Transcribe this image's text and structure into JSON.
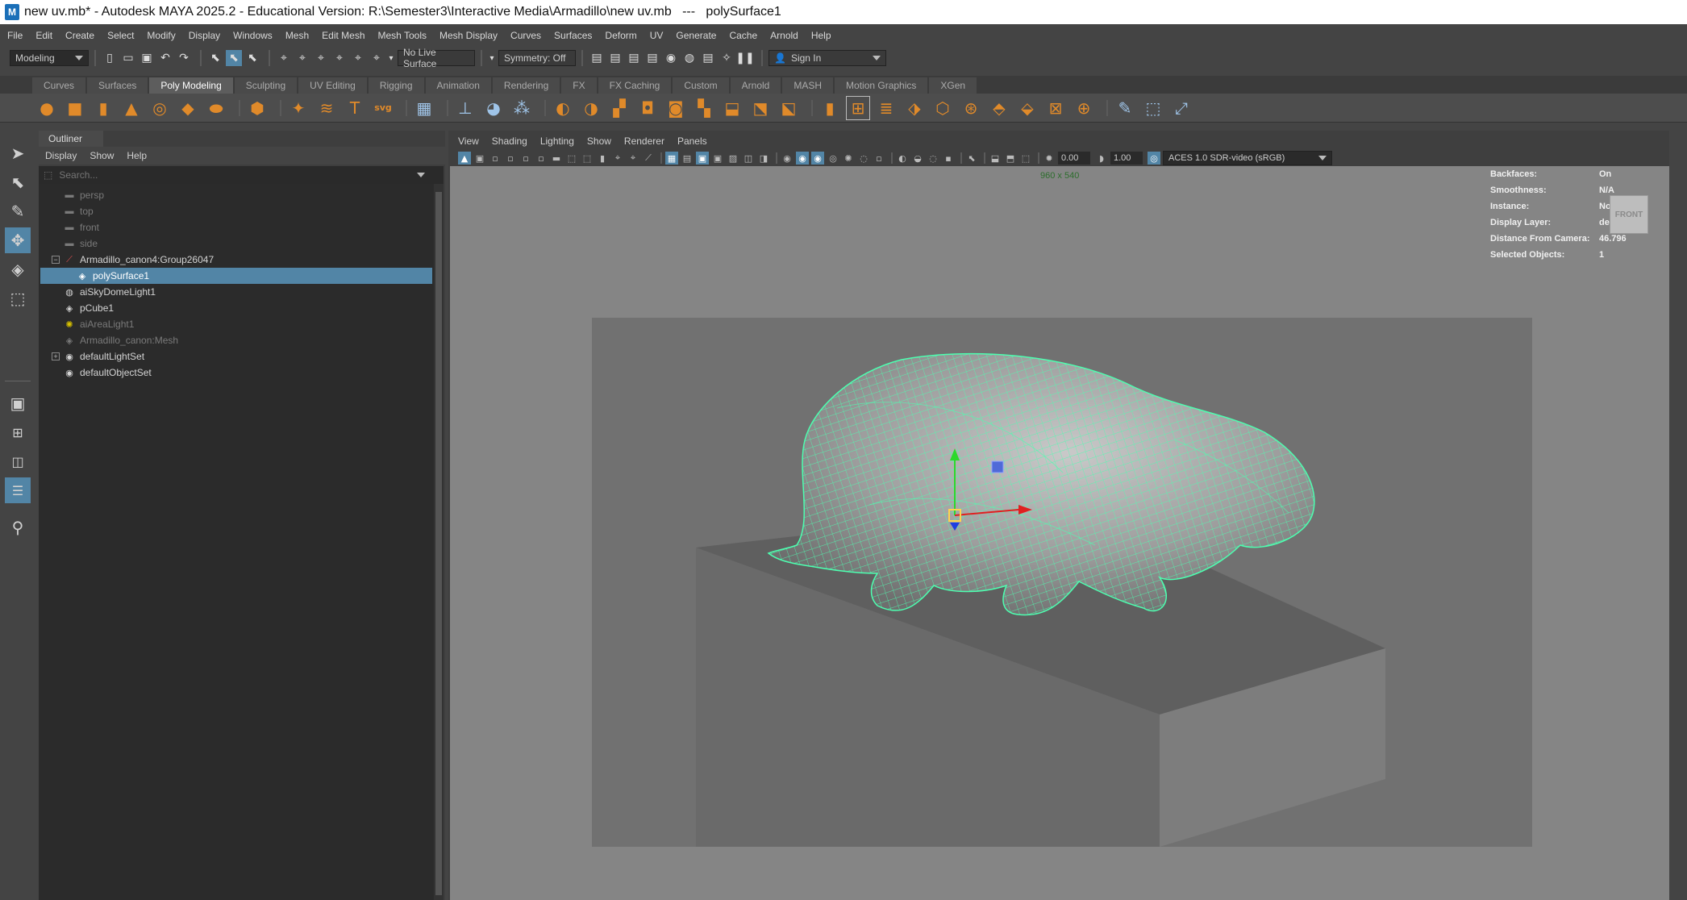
{
  "titlebar": {
    "title": "new uv.mb* - Autodesk MAYA 2025.2 - Educational Version: R:\\Semester3\\Interactive Media\\Armadillo\\new uv.mb   ---   polySurface1",
    "icon_letter": "M"
  },
  "menubar": {
    "items": [
      "File",
      "Edit",
      "Create",
      "Select",
      "Modify",
      "Display",
      "Windows",
      "Mesh",
      "Edit Mesh",
      "Mesh Tools",
      "Mesh Display",
      "Curves",
      "Surfaces",
      "Deform",
      "UV",
      "Generate",
      "Cache",
      "Arnold",
      "Help"
    ]
  },
  "statusline": {
    "menuset": "Modeling",
    "live_surface": "No Live Surface",
    "symmetry": "Symmetry: Off",
    "sign_in": "Sign In"
  },
  "shelf": {
    "tabs": [
      "Curves",
      "Surfaces",
      "Poly Modeling",
      "Sculpting",
      "UV Editing",
      "Rigging",
      "Animation",
      "Rendering",
      "FX",
      "FX Caching",
      "Custom",
      "Arnold",
      "MASH",
      "Motion Graphics",
      "XGen"
    ],
    "active_tab": "Poly Modeling"
  },
  "outliner": {
    "tab_label": "Outliner",
    "menu": [
      "Display",
      "Show",
      "Help"
    ],
    "search_placeholder": "Search...",
    "rows": [
      {
        "label": "persp",
        "icon": "camera-icon",
        "dim": true,
        "indent": 1
      },
      {
        "label": "top",
        "icon": "camera-icon",
        "dim": true,
        "indent": 1
      },
      {
        "label": "front",
        "icon": "camera-icon",
        "dim": true,
        "indent": 1
      },
      {
        "label": "side",
        "icon": "camera-icon",
        "dim": true,
        "indent": 1
      },
      {
        "label": "Armadillo_canon4:Group26047",
        "icon": "group-icon",
        "dim": false,
        "indent": 0,
        "expander": "−"
      },
      {
        "label": "polySurface1",
        "icon": "mesh-icon",
        "dim": false,
        "indent": 2,
        "selected": true
      },
      {
        "label": "aiSkyDomeLight1",
        "icon": "skydome-icon",
        "dim": false,
        "indent": 1
      },
      {
        "label": "pCube1",
        "icon": "mesh-icon",
        "dim": false,
        "indent": 1
      },
      {
        "label": "aiAreaLight1",
        "icon": "arealight-icon",
        "dim": true,
        "indent": 1
      },
      {
        "label": "Armadillo_canon:Mesh",
        "icon": "mesh-icon",
        "dim": true,
        "indent": 1
      },
      {
        "label": "defaultLightSet",
        "icon": "set-icon",
        "dim": false,
        "indent": 0,
        "expander": "+"
      },
      {
        "label": "defaultObjectSet",
        "icon": "set-icon",
        "dim": false,
        "indent": 1
      }
    ]
  },
  "panel": {
    "menu": [
      "View",
      "Shading",
      "Lighting",
      "Show",
      "Renderer",
      "Panels"
    ],
    "exposure": "0.00",
    "gamma": "1.00",
    "color_space": "ACES 1.0 SDR-video (sRGB)",
    "resolution": "960 x 540",
    "viewcube_label": "FRONT",
    "hud": [
      {
        "key": "Backfaces:",
        "value": "On"
      },
      {
        "key": "Smoothness:",
        "value": "N/A"
      },
      {
        "key": "Instance:",
        "value": "No"
      },
      {
        "key": "Display Layer:",
        "value": "default"
      },
      {
        "key": "Distance From Camera:",
        "value": "46.796"
      },
      {
        "key": "Selected Objects:",
        "value": "1"
      }
    ]
  },
  "colors": {
    "selection": "#5285a6",
    "wireframe": "#4dffb0",
    "shelf_icon": "#e08a2a"
  }
}
